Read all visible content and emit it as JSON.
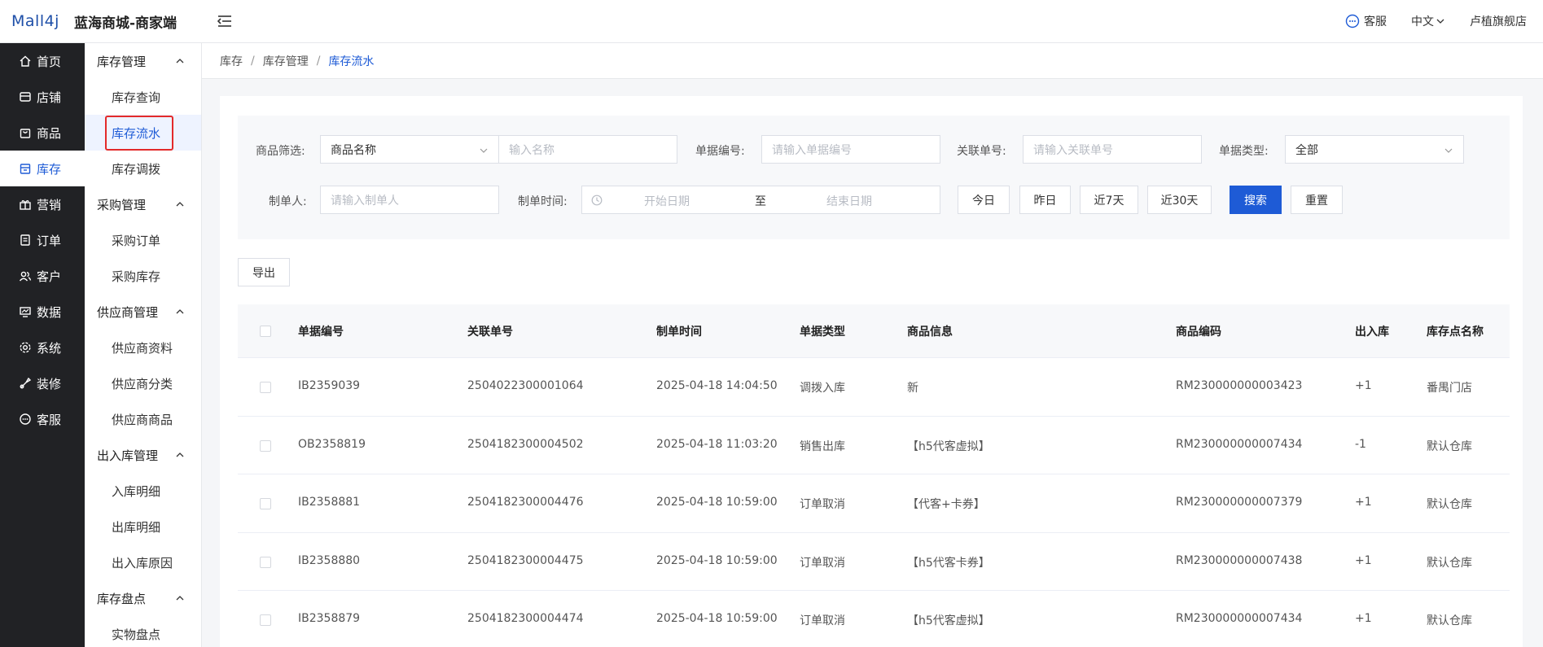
{
  "header": {
    "logo_text": "Mall4j",
    "shop_title": "蓝海商城-商家端",
    "customer_service": "客服",
    "language": "中文",
    "store_name": "卢植旗舰店"
  },
  "nav_primary": [
    {
      "label": "首页",
      "icon": "home-icon"
    },
    {
      "label": "店铺",
      "icon": "store-icon"
    },
    {
      "label": "商品",
      "icon": "bag-icon"
    },
    {
      "label": "库存",
      "icon": "inventory-icon",
      "active": true
    },
    {
      "label": "营销",
      "icon": "gift-icon"
    },
    {
      "label": "订单",
      "icon": "order-icon"
    },
    {
      "label": "客户",
      "icon": "users-icon"
    },
    {
      "label": "数据",
      "icon": "chart-icon"
    },
    {
      "label": "系统",
      "icon": "gear-icon"
    },
    {
      "label": "装修",
      "icon": "brush-icon"
    },
    {
      "label": "客服",
      "icon": "chat-icon"
    }
  ],
  "nav_secondary": {
    "groups": [
      {
        "label": "库存管理",
        "items": [
          "库存查询",
          "库存流水",
          "库存调拨"
        ]
      },
      {
        "label": "采购管理",
        "items": [
          "采购订单",
          "采购库存"
        ]
      },
      {
        "label": "供应商管理",
        "items": [
          "供应商资料",
          "供应商分类",
          "供应商商品"
        ]
      },
      {
        "label": "出入库管理",
        "items": [
          "入库明细",
          "出库明细",
          "出入库原因"
        ]
      },
      {
        "label": "库存盘点",
        "items": [
          "实物盘点"
        ]
      }
    ],
    "active_item": "库存流水"
  },
  "breadcrumb": [
    "库存",
    "库存管理",
    "库存流水"
  ],
  "filters": {
    "product_filter_label": "商品筛选:",
    "product_filter_select": "商品名称",
    "product_name_placeholder": "输入名称",
    "doc_no_label": "单据编号:",
    "doc_no_placeholder": "请输入单据编号",
    "related_no_label": "关联单号:",
    "related_no_placeholder": "请输入关联单号",
    "doc_type_label": "单据类型:",
    "doc_type_value": "全部",
    "creator_label": "制单人:",
    "creator_placeholder": "请输入制单人",
    "time_label": "制单时间:",
    "start_date_placeholder": "开始日期",
    "range_sep": "至",
    "end_date_placeholder": "结束日期",
    "quick_buttons": [
      "今日",
      "昨日",
      "近7天",
      "近30天"
    ],
    "search_label": "搜索",
    "reset_label": "重置"
  },
  "export_label": "导出",
  "table": {
    "columns": [
      "单据编号",
      "关联单号",
      "制单时间",
      "单据类型",
      "商品信息",
      "商品编码",
      "出入库",
      "库存点名称"
    ],
    "rows": [
      [
        "IB2359039",
        "2504022300001064",
        "2025-04-18 14:04:50",
        "调拨入库",
        "新",
        "RM230000000003423",
        "+1",
        "番禺门店"
      ],
      [
        "OB2358819",
        "2504182300004502",
        "2025-04-18 11:03:20",
        "销售出库",
        "【h5代客虚拟】",
        "RM230000000007434",
        "-1",
        "默认仓库"
      ],
      [
        "IB2358881",
        "2504182300004476",
        "2025-04-18 10:59:00",
        "订单取消",
        "【代客+卡券】",
        "RM230000000007379",
        "+1",
        "默认仓库"
      ],
      [
        "IB2358880",
        "2504182300004475",
        "2025-04-18 10:59:00",
        "订单取消",
        "【h5代客卡券】",
        "RM230000000007438",
        "+1",
        "默认仓库"
      ],
      [
        "IB2358879",
        "2504182300004474",
        "2025-04-18 10:59:00",
        "订单取消",
        "【h5代客虚拟】",
        "RM230000000007434",
        "+1",
        "默认仓库"
      ]
    ]
  }
}
